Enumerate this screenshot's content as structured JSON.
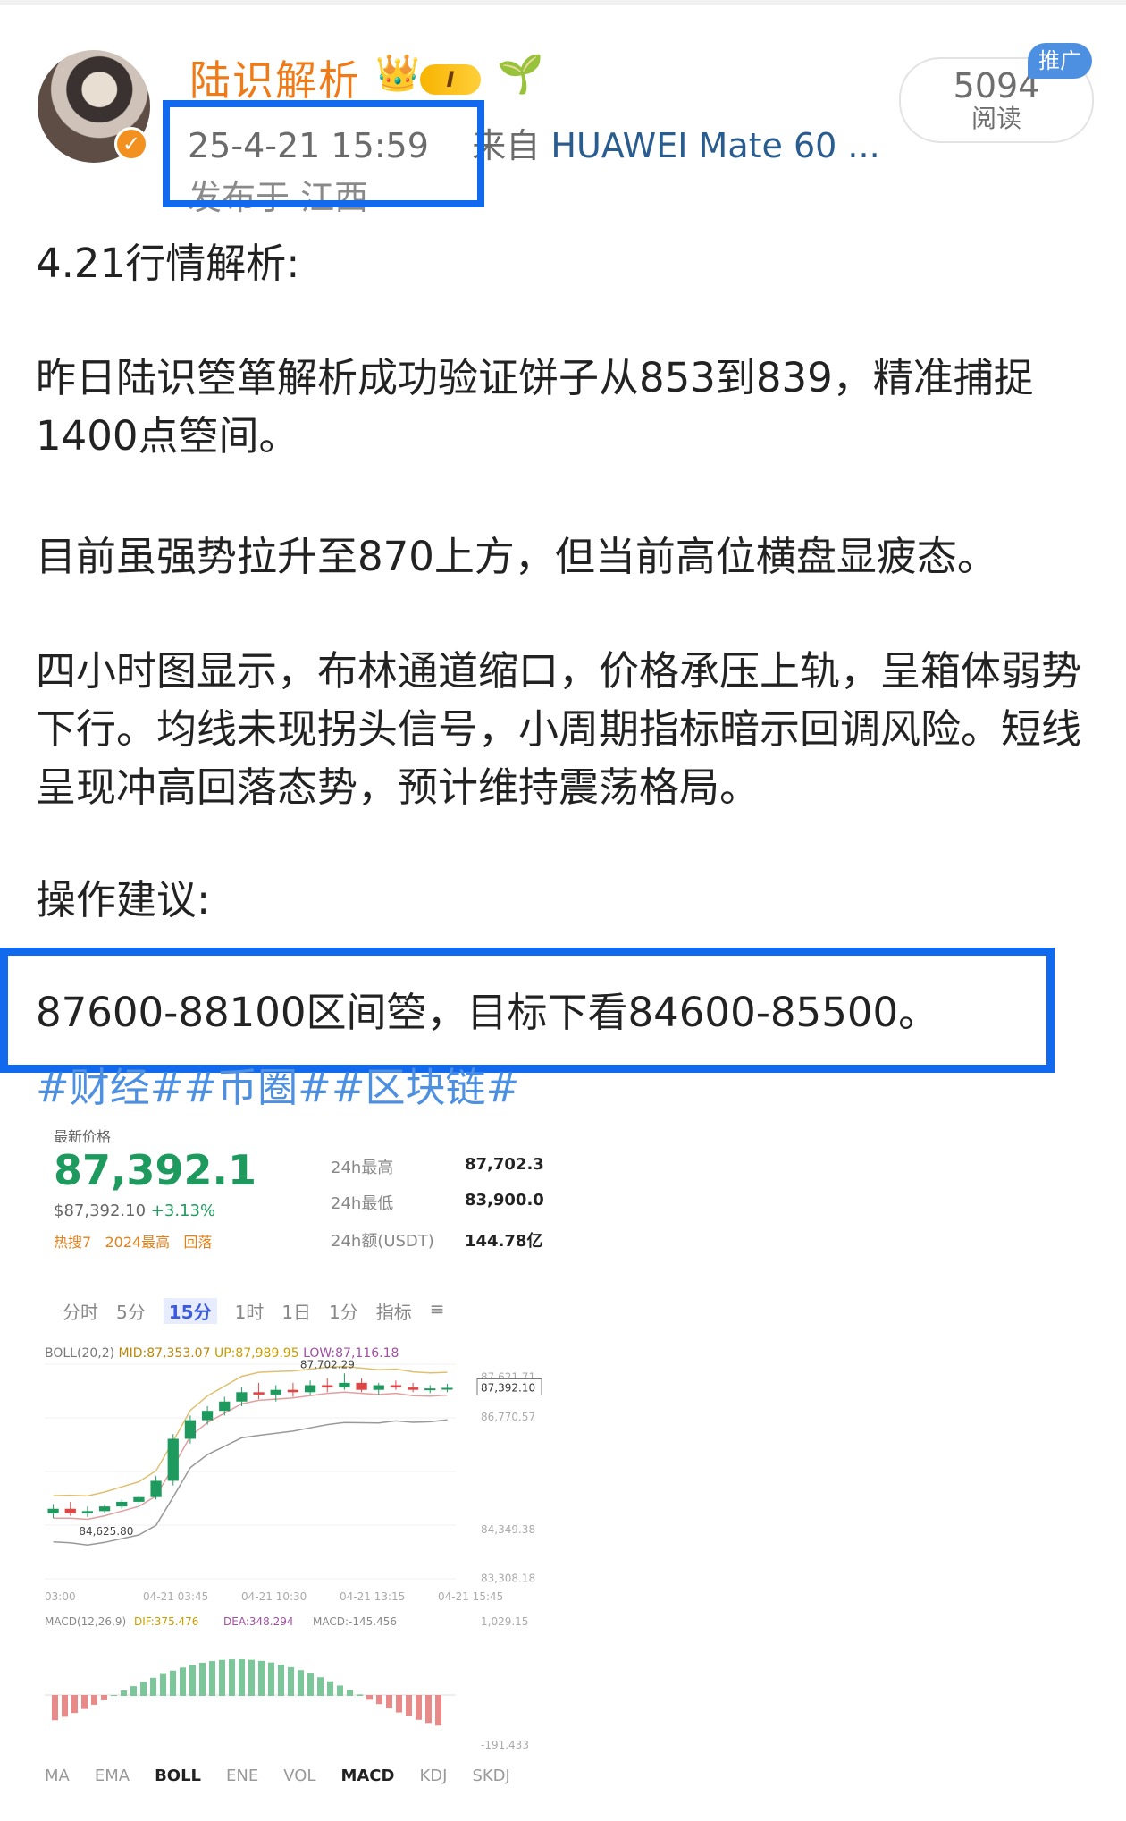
{
  "post": {
    "username": "陆识解析",
    "level_badge": "I",
    "time": "25-4-21 15:59",
    "source_prefix": "来自",
    "source_device": "HUAWEI Mate 60 ...",
    "location": "发布于 江西",
    "reads_count": "5094",
    "reads_label": "阅读",
    "promo_label": "推广",
    "paragraphs": [
      "4.21行情解析:",
      "昨日陆识箜箪解析成功验证饼子从853到839，精准捕捉1400点箜间。",
      "目前虽强势拉升至870上方，但当前高位横盘显疲态。",
      "四小时图显示，布林通道缩口，价格承压上轨，呈箱体弱势下行。均线未现拐头信号，小周期指标暗示回调风险。短线呈现冲高回落态势，预计维持震荡格局。",
      "操作建议:",
      "87600-88100区间箜，目标下看84600-85500。"
    ],
    "hashtags": "#财经##币圈##区块链#"
  },
  "chart_image": {
    "latest_label": "最新价格",
    "price": "87,392.1",
    "usd_price": "$87,392.10",
    "change_pct": "+3.13%",
    "tag_labels": [
      "热搜7",
      "2024最高",
      "回落"
    ],
    "stats": [
      {
        "label": "24h最高",
        "value": "87,702.3"
      },
      {
        "label": "24h最低",
        "value": "83,900.0"
      },
      {
        "label": "24h额(USDT)",
        "value": "144.78亿"
      }
    ],
    "timeframes": [
      "分时",
      "5分",
      "15分",
      "1时",
      "1日",
      "1分",
      "指标",
      "≡"
    ],
    "active_timeframe": "15分",
    "boll_prefix": "BOLL(20,2)",
    "boll_mid": "MID:87,353.07",
    "boll_up": "UP:87,989.95",
    "boll_low": "LOW:87,116.18",
    "bottom_tabs": [
      "MA",
      "EMA",
      "BOLL",
      "ENE",
      "VOL",
      "MACD",
      "KDJ",
      "SKDJ"
    ],
    "bottom_selected": [
      "BOLL",
      "MACD"
    ],
    "colors": {
      "up": "#1f9a5e",
      "down": "#e04545"
    }
  },
  "chart_data": {
    "type": "candlestick",
    "title": "",
    "y_ticks": [
      "87,621.71",
      "87,392.10",
      "86,770.57",
      "84,349.38",
      "83,308.18"
    ],
    "x_ticks": [
      "03:00",
      "04-21 03:45",
      "04-21 10:30",
      "04-21 13:15",
      "04-21 15:45"
    ],
    "annotations": [
      "87,702.29",
      "84,625.80"
    ],
    "macd_label": "MACD(12,26,9)",
    "macd_dif": "DIF:375.476",
    "macd_dea": "DEA:348.294",
    "macd_value": "MACD:-145.456",
    "macd_ticks": [
      "1,029.15",
      "-191.433"
    ],
    "candles": [
      {
        "o": 84700,
        "h": 84900,
        "l": 84600,
        "c": 84800
      },
      {
        "o": 84800,
        "h": 84950,
        "l": 84650,
        "c": 84700
      },
      {
        "o": 84700,
        "h": 84850,
        "l": 84625.8,
        "c": 84750
      },
      {
        "o": 84750,
        "h": 84900,
        "l": 84700,
        "c": 84850
      },
      {
        "o": 84850,
        "h": 85000,
        "l": 84800,
        "c": 84950
      },
      {
        "o": 84950,
        "h": 85100,
        "l": 84850,
        "c": 85050
      },
      {
        "o": 85050,
        "h": 85500,
        "l": 85000,
        "c": 85400
      },
      {
        "o": 85400,
        "h": 86400,
        "l": 85300,
        "c": 86300
      },
      {
        "o": 86300,
        "h": 86800,
        "l": 86200,
        "c": 86700
      },
      {
        "o": 86700,
        "h": 87000,
        "l": 86600,
        "c": 86900
      },
      {
        "o": 86900,
        "h": 87200,
        "l": 86800,
        "c": 87100
      },
      {
        "o": 87100,
        "h": 87400,
        "l": 87000,
        "c": 87300
      },
      {
        "o": 87300,
        "h": 87500,
        "l": 87150,
        "c": 87250
      },
      {
        "o": 87250,
        "h": 87450,
        "l": 87100,
        "c": 87350
      },
      {
        "o": 87350,
        "h": 87500,
        "l": 87200,
        "c": 87300
      },
      {
        "o": 87300,
        "h": 87550,
        "l": 87250,
        "c": 87450
      },
      {
        "o": 87450,
        "h": 87600,
        "l": 87300,
        "c": 87400
      },
      {
        "o": 87400,
        "h": 87702.29,
        "l": 87350,
        "c": 87500
      },
      {
        "o": 87500,
        "h": 87600,
        "l": 87300,
        "c": 87350
      },
      {
        "o": 87350,
        "h": 87500,
        "l": 87250,
        "c": 87450
      },
      {
        "o": 87450,
        "h": 87550,
        "l": 87350,
        "c": 87400
      },
      {
        "o": 87400,
        "h": 87500,
        "l": 87300,
        "c": 87350
      },
      {
        "o": 87350,
        "h": 87450,
        "l": 87280,
        "c": 87380
      },
      {
        "o": 87380,
        "h": 87480,
        "l": 87300,
        "c": 87392.1
      }
    ]
  }
}
